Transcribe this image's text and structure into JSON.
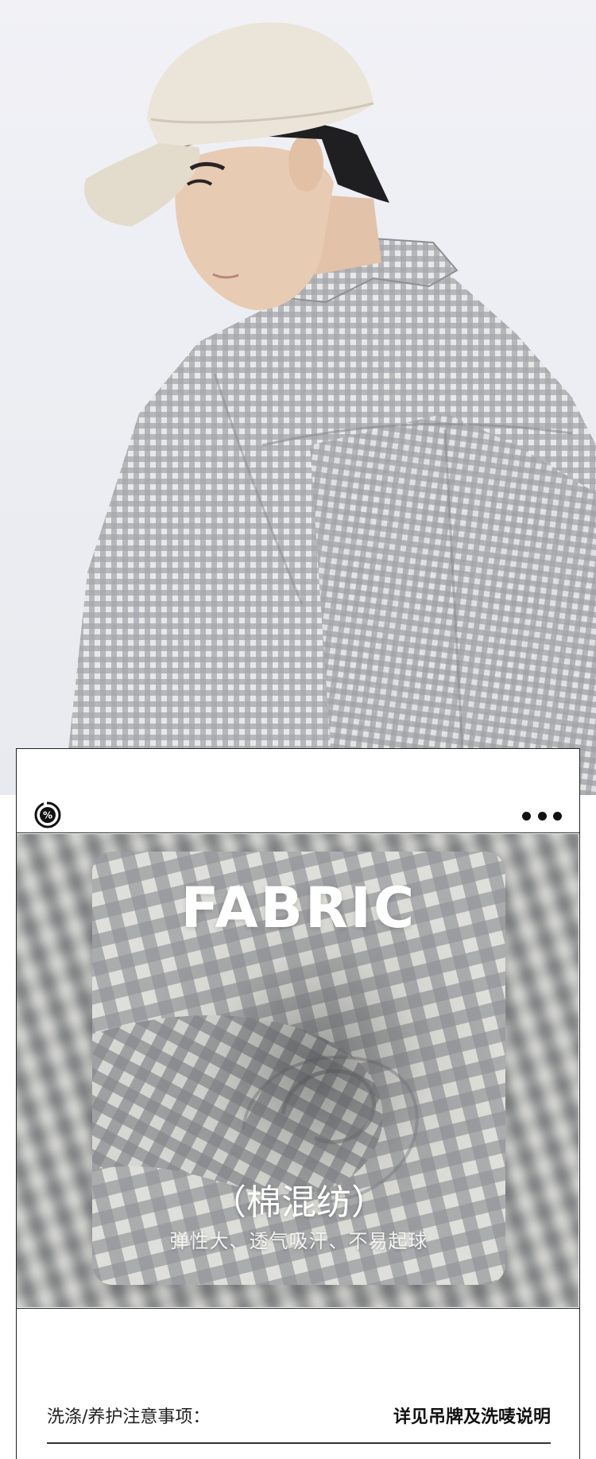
{
  "hero": {
    "image": "model-wearing-gingham-shirt-and-cap",
    "colors": {
      "background": "#eceef3",
      "shirt": "#8f9196",
      "cap": "#e9e3d7",
      "skin": "#e6c7ae",
      "hair": "#1d1d1f"
    }
  },
  "card": {
    "icons": {
      "left": "percent-badge-icon",
      "right": "more-dots-icon"
    },
    "fabric": {
      "title": "FABRIC",
      "material": "（棉混纺）",
      "features": "弹性大、透气吸汗、不易起球"
    },
    "care": {
      "label": "洗涤/养护注意事项：",
      "value": "详见吊牌及洗唛说明"
    }
  }
}
